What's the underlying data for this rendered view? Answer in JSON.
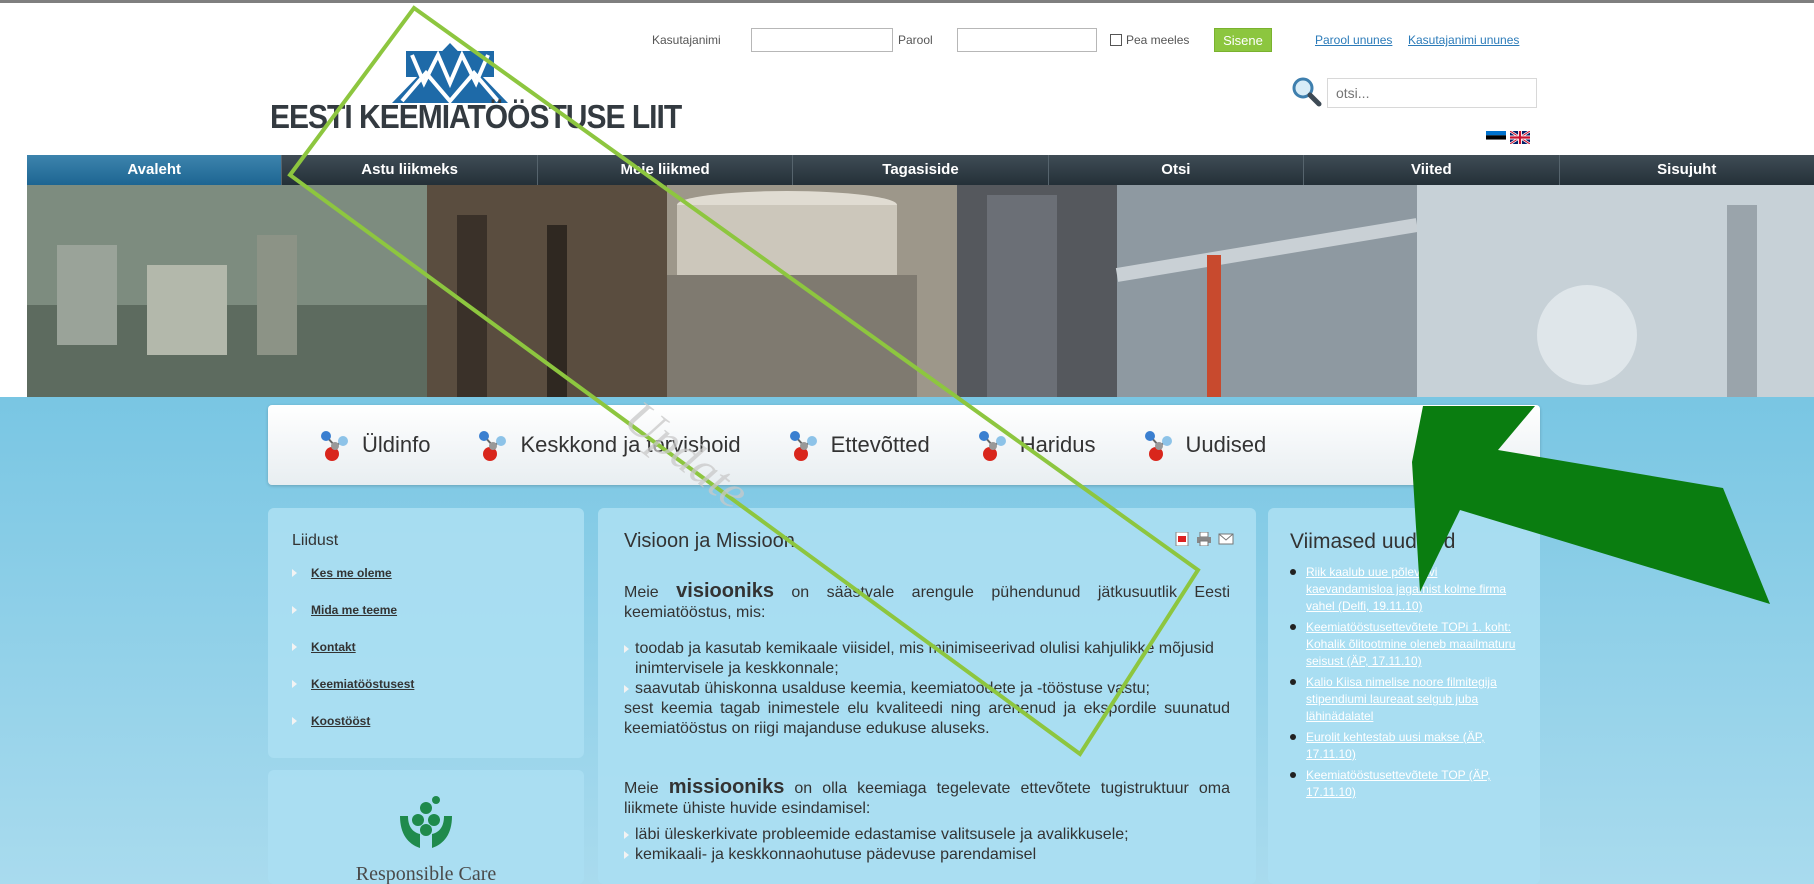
{
  "header": {
    "logo_text": "EESTI KEEMIATÖÖSTUSE LIIT",
    "login": {
      "username_label": "Kasutajanimi",
      "username_value": "",
      "password_label": "Parool",
      "password_value": "",
      "remember_label": "Pea meeles",
      "submit_label": "Sisene",
      "forgot_password": "Parool ununes",
      "forgot_username": "Kasutajanimi ununes"
    },
    "search_placeholder": "otsi..."
  },
  "nav": [
    {
      "label": "Avaleht",
      "active": true
    },
    {
      "label": "Astu liikmeks"
    },
    {
      "label": "Meie liikmed"
    },
    {
      "label": "Tagasiside"
    },
    {
      "label": "Otsi"
    },
    {
      "label": "Viited"
    },
    {
      "label": "Sisujuht"
    }
  ],
  "categories": [
    "Üldinfo",
    "Keskkond ja tervishoid",
    "Ettevõtted",
    "Haridus",
    "Uudised"
  ],
  "left_panel": {
    "title": "Liidust",
    "links": [
      "Kes me oleme",
      "Mida me teeme",
      "Kontakt",
      "Keemiatööstusest",
      "Koostööst"
    ]
  },
  "responsible_care": "Responsible Care",
  "article": {
    "title": "Visioon ja Missioon",
    "p1_pre": "Meie ",
    "p1_bold": "visiooniks",
    "p1_post": " on säästvale arengule pühendunud jätkusuutlik Eesti keemiatööstus, mis:",
    "bullets1": [
      "toodab ja kasutab kemikaale viisidel, mis minimiseerivad olulisi kahjulikke mõjusid inimtervisele ja keskkonnale;",
      "saavutab ühiskonna usalduse keemia, keemiatoodete ja -tööstuse vastu;"
    ],
    "p2": "sest keemia tagab inimestele elu kvaliteedi ning arenenud ja ekspordile suunatud keemiatööstus on riigi majanduse edukuse aluseks.",
    "p3_pre": "Meie ",
    "p3_bold": "missiooniks",
    "p3_post": " on olla keemiaga tegelevate ettevõtete tugistruktuur oma liikmete ühiste huvide esindamisel:",
    "bullets2": [
      "läbi üleskerkivate probleemide edastamise valitsusele ja avalikkusele;",
      "kemikaali- ja keskkonnaohutuse pädevuse parendamisel"
    ]
  },
  "news": {
    "title": "Viimased uudised",
    "items": [
      "Riik kaalub uue põlevkivi kaevandamisloa jagamist kolme firma vahel (Delfi, 19.11.10)",
      "Keemiatööstusettevõtete TOPi 1. koht: Kohalik õlitootmine oleneb maailmaturu seisust (ÄP, 17.11.10)",
      "Kalio Kiisa nimelise noore filmitegija stipendiumi laureaat selgub juba lähinädalatel",
      "Eurolit kehtestab uusi makse (ÄP, 17.11.10)",
      "Keemiatööstusettevõtete TOP (ÄP, 17.11.10)"
    ]
  },
  "watermark": "Update",
  "colors": {
    "nav_active": "#2575a3",
    "accent_green": "#8cc63f",
    "arrow_green": "#0a7d10",
    "content_blue": "#8fd0ea"
  }
}
